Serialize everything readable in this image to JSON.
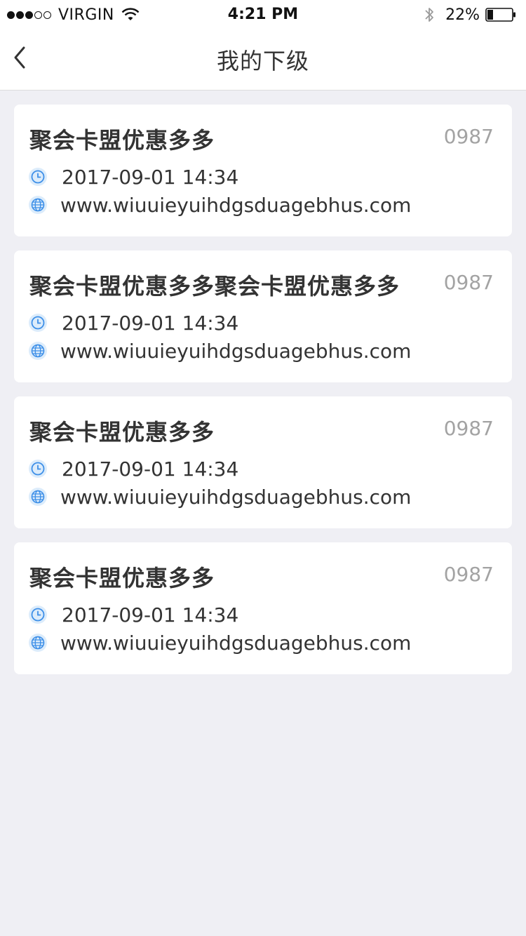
{
  "status_bar": {
    "carrier": "VIRGIN",
    "time": "4:21 PM",
    "battery": "22%"
  },
  "nav": {
    "title": "我的下级"
  },
  "cards": [
    {
      "title": "聚会卡盟优惠多多",
      "code": "0987",
      "time": "2017-09-01  14:34",
      "url": "www.wiuuieyuihdgsduagebhus.com"
    },
    {
      "title": "聚会卡盟优惠多多聚会卡盟优惠多多",
      "code": "0987",
      "time": "2017-09-01  14:34",
      "url": "www.wiuuieyuihdgsduagebhus.com"
    },
    {
      "title": "聚会卡盟优惠多多",
      "code": "0987",
      "time": "2017-09-01  14:34",
      "url": "www.wiuuieyuihdgsduagebhus.com"
    },
    {
      "title": "聚会卡盟优惠多多",
      "code": "0987",
      "time": "2017-09-01  14:34",
      "url": "www.wiuuieyuihdgsduagebhus.com"
    }
  ],
  "icons": {
    "time": "clock-icon",
    "url": "globe-icon",
    "back": "chevron-left-icon"
  },
  "colors": {
    "background": "#efeff4",
    "card": "#ffffff",
    "icon_accent": "#3d8fe8",
    "icon_bg": "#dcecfb",
    "code_text": "#a3a3a3"
  }
}
